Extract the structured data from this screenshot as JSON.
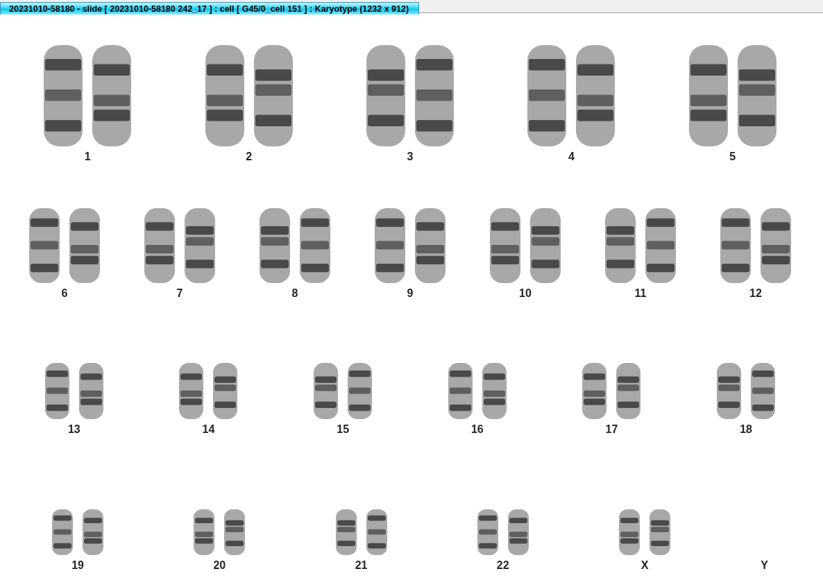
{
  "window": {
    "title": "20231010-58180 - slide [ 20231010-58180 242_17 ] : cell [ G45/0_cell 151 ] : Karyotype  (1232 x 912)"
  },
  "karyotype_rows": [
    {
      "groups": [
        {
          "label": "1",
          "kind": "pair"
        },
        {
          "label": "2",
          "kind": "pair"
        },
        {
          "label": "3",
          "kind": "pair"
        },
        {
          "label": "4",
          "kind": "pair"
        },
        {
          "label": "5",
          "kind": "pair"
        }
      ]
    },
    {
      "groups": [
        {
          "label": "6",
          "kind": "pair"
        },
        {
          "label": "7",
          "kind": "pair"
        },
        {
          "label": "8",
          "kind": "pair"
        },
        {
          "label": "9",
          "kind": "pair"
        },
        {
          "label": "10",
          "kind": "pair"
        },
        {
          "label": "11",
          "kind": "pair"
        },
        {
          "label": "12",
          "kind": "pair"
        }
      ]
    },
    {
      "groups": [
        {
          "label": "13",
          "kind": "pair"
        },
        {
          "label": "14",
          "kind": "pair"
        },
        {
          "label": "15",
          "kind": "pair"
        },
        {
          "label": "16",
          "kind": "pair"
        },
        {
          "label": "17",
          "kind": "pair"
        },
        {
          "label": "18",
          "kind": "pair"
        }
      ]
    },
    {
      "groups": [
        {
          "label": "19",
          "kind": "pair"
        },
        {
          "label": "20",
          "kind": "pair"
        },
        {
          "label": "21",
          "kind": "pair"
        },
        {
          "label": "22",
          "kind": "pair"
        },
        {
          "label": "X",
          "kind": "pair"
        },
        {
          "label": "Y",
          "kind": "empty"
        }
      ]
    }
  ]
}
